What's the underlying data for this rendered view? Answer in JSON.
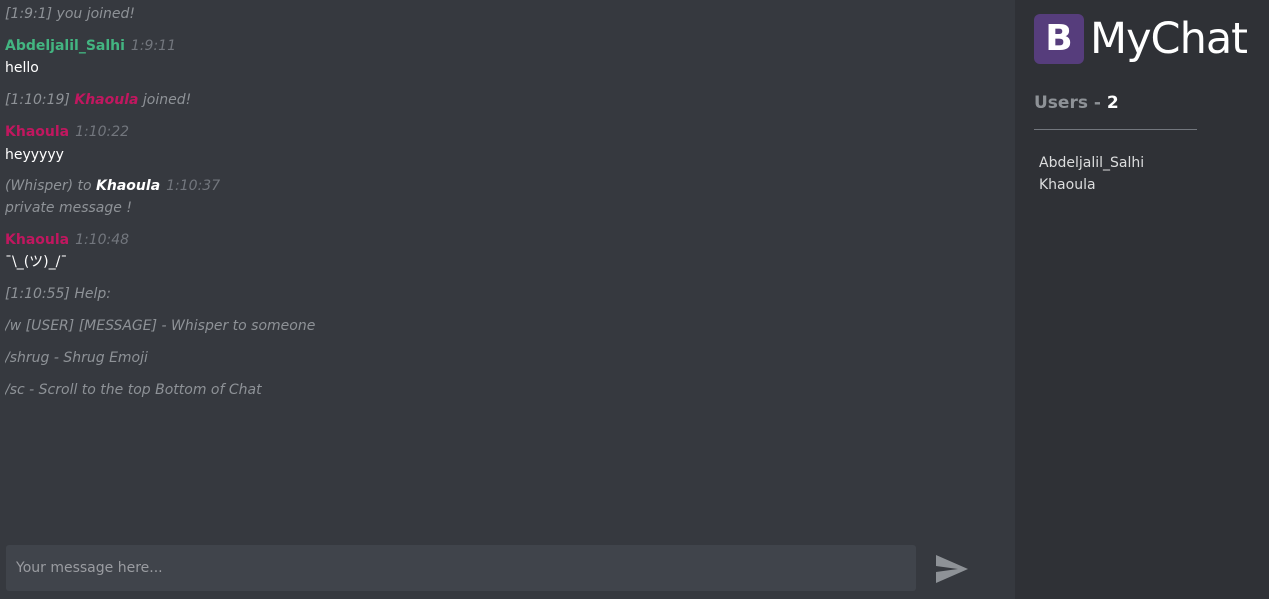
{
  "chat": {
    "messages": [
      {
        "kind": "system",
        "text": "[1:9:1] you joined!"
      },
      {
        "kind": "message",
        "user": "Abdeljalil_Salhi",
        "time": "1:9:11",
        "body": "hello"
      },
      {
        "kind": "join",
        "prefix": "[1:10:19]",
        "user": "Khaoula",
        "suffix": "joined!"
      },
      {
        "kind": "message",
        "user": "Khaoula",
        "time": "1:10:22",
        "body": "heyyyyy"
      },
      {
        "kind": "whisper",
        "prefix": "(Whisper) to",
        "user": "Khaoula",
        "time": "1:10:37",
        "body": "private message !"
      },
      {
        "kind": "message",
        "user": "Khaoula",
        "time": "1:10:48",
        "body": "¯\\_(ツ)_/¯"
      },
      {
        "kind": "system",
        "text": "[1:10:55]  Help:"
      },
      {
        "kind": "system",
        "text": "/w [USER] [MESSAGE] - Whisper to someone"
      },
      {
        "kind": "system",
        "text": "/shrug - Shrug Emoji"
      },
      {
        "kind": "system",
        "text": "/sc - Scroll to the top Bottom of Chat"
      }
    ],
    "composer_placeholder": "Your message here...",
    "composer_value": "",
    "send_icon": "send-icon"
  },
  "sidebar": {
    "logo_letter": "B",
    "brand_name": "MyChat",
    "users_label": "Users -",
    "users_count": "2",
    "users": [
      "Abdeljalil_Salhi",
      "Khaoula"
    ]
  },
  "colors": {
    "chat_bg": "#36393f",
    "sidebar_bg": "#2f3136",
    "composer_bg": "#40444b",
    "logo_bg": "#563d7c",
    "user_green": "#43b581",
    "user_pink": "#c1175f",
    "muted": "#8e9297"
  }
}
